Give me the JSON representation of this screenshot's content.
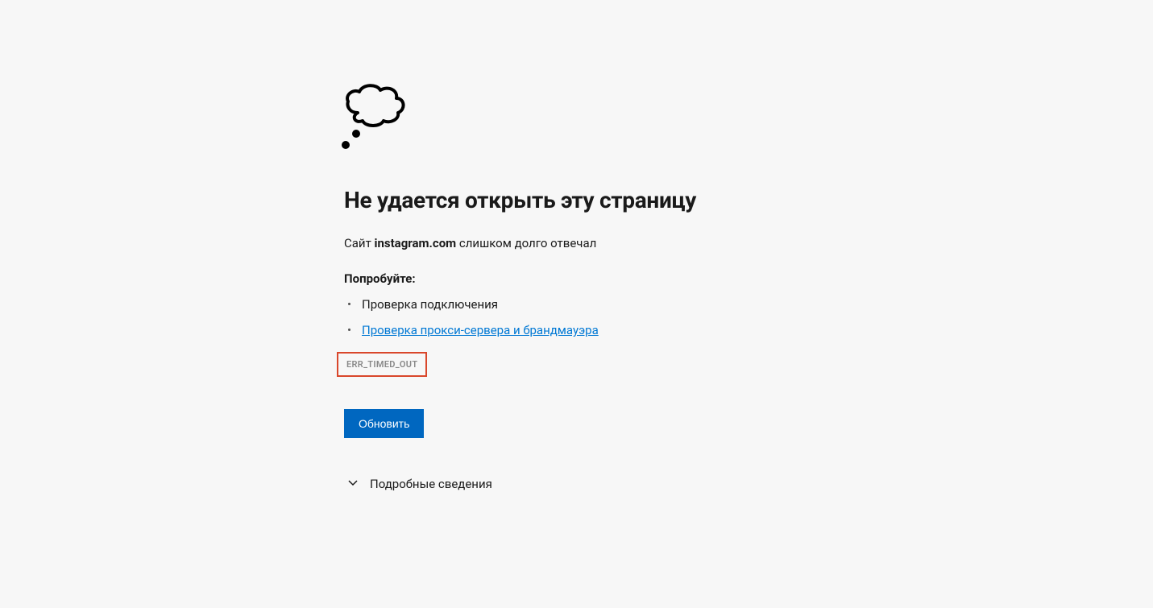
{
  "title": "Не удается открыть эту страницу",
  "subtitle_prefix": "Сайт ",
  "subtitle_domain": "instagram.com",
  "subtitle_suffix": " слишком долго отвечал",
  "try_label": "Попробуйте:",
  "suggestions": {
    "item1": "Проверка подключения",
    "item2": "Проверка прокси-сервера и брандмауэра"
  },
  "error_code": "ERR_TIMED_OUT",
  "reload_button": "Обновить",
  "details_label": "Подробные сведения"
}
